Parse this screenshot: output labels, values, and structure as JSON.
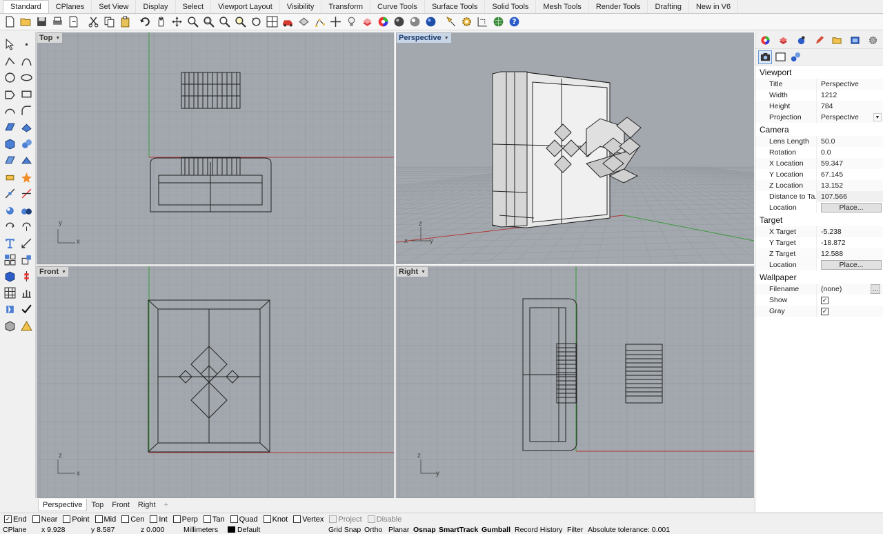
{
  "tabs": [
    "Standard",
    "CPlanes",
    "Set View",
    "Display",
    "Select",
    "Viewport Layout",
    "Visibility",
    "Transform",
    "Curve Tools",
    "Surface Tools",
    "Solid Tools",
    "Mesh Tools",
    "Render Tools",
    "Drafting",
    "New in V6"
  ],
  "active_tab": "Standard",
  "viewports": {
    "top": {
      "label": "Top",
      "axis_v": "y",
      "axis_h": "x"
    },
    "perspective": {
      "label": "Perspective",
      "axis_v": "z",
      "axis_h": "x",
      "axis_h2": "y"
    },
    "front": {
      "label": "Front",
      "axis_v": "z",
      "axis_h": "x"
    },
    "right": {
      "label": "Right",
      "axis_v": "z",
      "axis_h": "y"
    }
  },
  "viewport_tabs": [
    "Perspective",
    "Top",
    "Front",
    "Right"
  ],
  "active_viewport_tab": "Perspective",
  "panel": {
    "viewport_title": "Viewport",
    "viewport_rows": [
      {
        "key": "Title",
        "value": "Perspective"
      },
      {
        "key": "Width",
        "value": "1212"
      },
      {
        "key": "Height",
        "value": "784"
      }
    ],
    "projection": {
      "key": "Projection",
      "value": "Perspective"
    },
    "camera_title": "Camera",
    "camera_rows": [
      {
        "key": "Lens Length",
        "value": "50.0"
      },
      {
        "key": "Rotation",
        "value": "0.0"
      },
      {
        "key": "X Location",
        "value": "59.347"
      },
      {
        "key": "Y Location",
        "value": "67.145"
      },
      {
        "key": "Z Location",
        "value": "13.152"
      },
      {
        "key": "Distance to Ta...",
        "value": "107.566"
      }
    ],
    "camera_location": {
      "key": "Location",
      "button": "Place..."
    },
    "target_title": "Target",
    "target_rows": [
      {
        "key": "X Target",
        "value": "-5.238"
      },
      {
        "key": "Y Target",
        "value": "-18.872"
      },
      {
        "key": "Z Target",
        "value": "12.588"
      }
    ],
    "target_location": {
      "key": "Location",
      "button": "Place..."
    },
    "wallpaper_title": "Wallpaper",
    "wallpaper_filename": {
      "key": "Filename",
      "value": "(none)",
      "button": "..."
    },
    "wallpaper_show": {
      "key": "Show",
      "checked": true
    },
    "wallpaper_gray": {
      "key": "Gray",
      "checked": true
    }
  },
  "osnap": [
    {
      "label": "End",
      "checked": true,
      "enabled": true
    },
    {
      "label": "Near",
      "checked": false,
      "enabled": true
    },
    {
      "label": "Point",
      "checked": false,
      "enabled": true
    },
    {
      "label": "Mid",
      "checked": false,
      "enabled": true
    },
    {
      "label": "Cen",
      "checked": false,
      "enabled": true
    },
    {
      "label": "Int",
      "checked": false,
      "enabled": true
    },
    {
      "label": "Perp",
      "checked": false,
      "enabled": true
    },
    {
      "label": "Tan",
      "checked": false,
      "enabled": true
    },
    {
      "label": "Quad",
      "checked": false,
      "enabled": true
    },
    {
      "label": "Knot",
      "checked": false,
      "enabled": true
    },
    {
      "label": "Vertex",
      "checked": false,
      "enabled": true
    },
    {
      "label": "Project",
      "checked": false,
      "enabled": false
    },
    {
      "label": "Disable",
      "checked": false,
      "enabled": false
    }
  ],
  "status": {
    "cplane": "CPlane",
    "x": "x 9.928",
    "y": "y 8.587",
    "z": "z 0.000",
    "units": "Millimeters",
    "layer": "Default",
    "grid_snap": "Grid Snap",
    "ortho": "Ortho",
    "planar": "Planar",
    "osnap": "Osnap",
    "smarttrack": "SmartTrack",
    "gumball": "Gumball",
    "record_history": "Record History",
    "filter": "Filter",
    "tolerance": "Absolute tolerance: 0.001"
  },
  "colors": {
    "viewport_bg": "#a3a8ae",
    "grid_minor": "#9aa0a6",
    "grid_major": "#8e949a",
    "x_axis": "#b03a3a",
    "y_axis": "#3a9a3a",
    "active_label": "#c9d6e8"
  }
}
